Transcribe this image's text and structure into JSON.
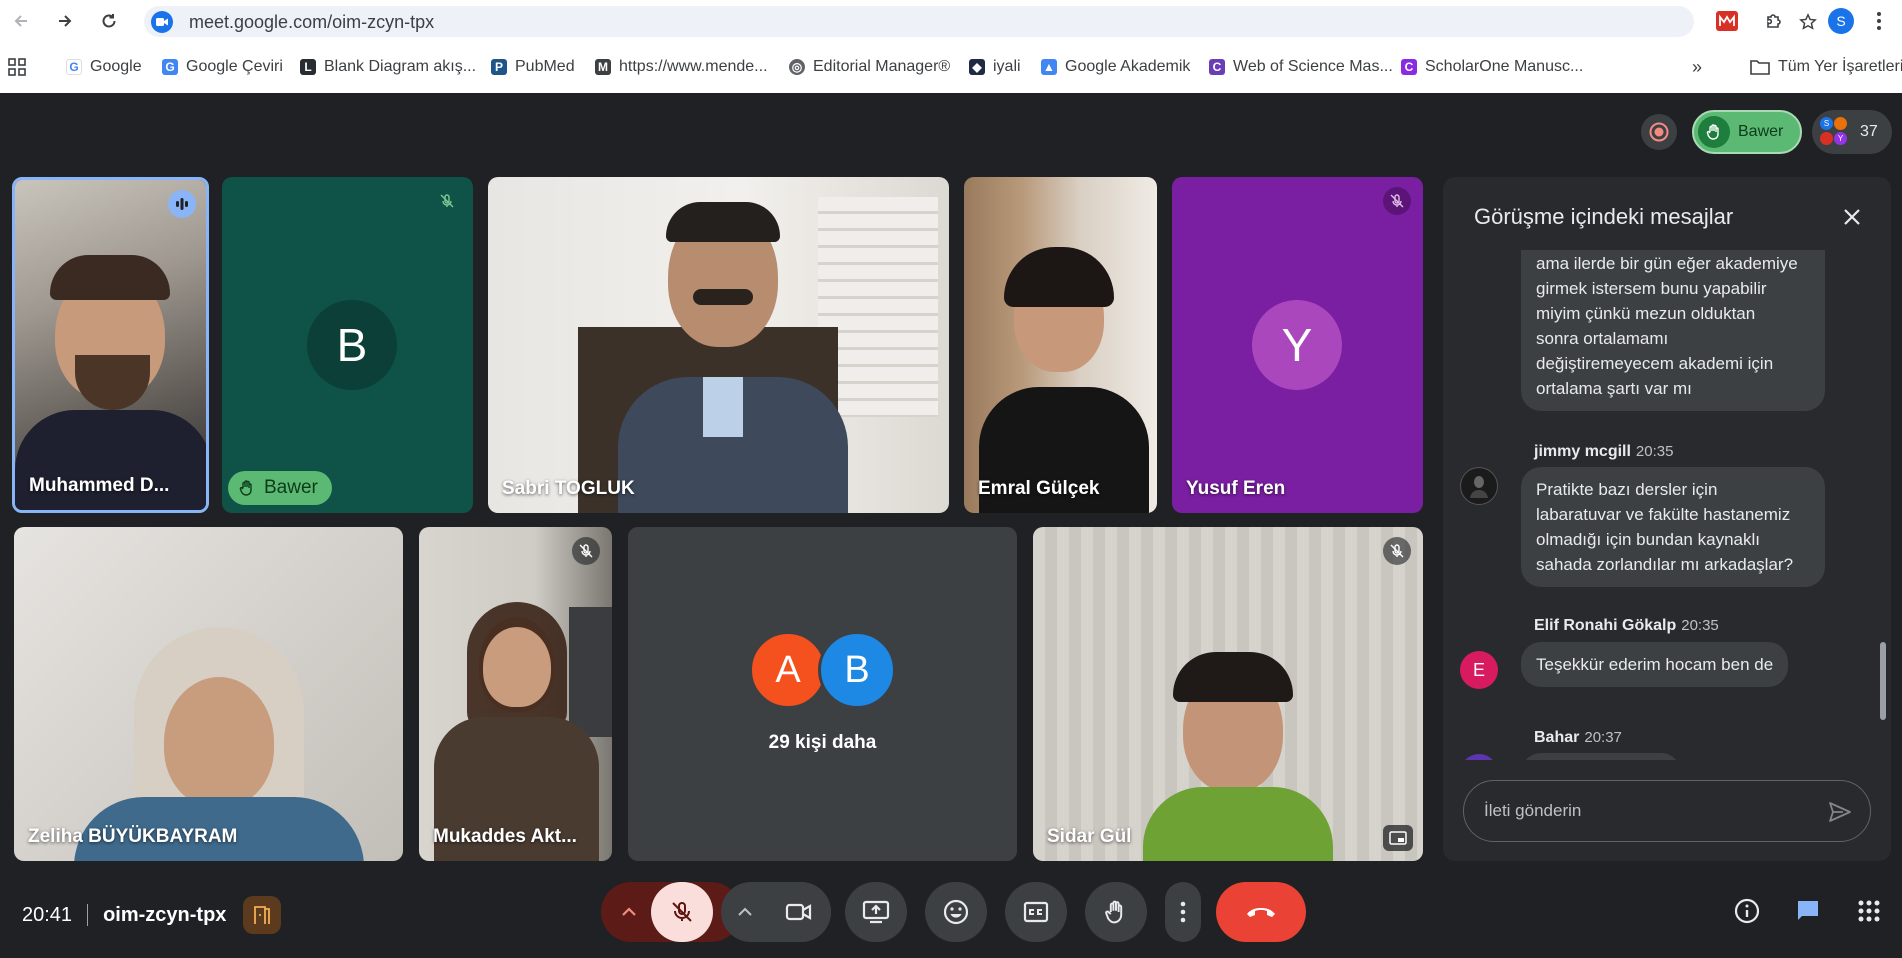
{
  "browser": {
    "url": "meet.google.com/oim-zcyn-tpx",
    "profile_initial": "S",
    "bookmarks": [
      {
        "label": "Google",
        "icon": "google-icon"
      },
      {
        "label": "Google Çeviri",
        "icon": "translate-icon"
      },
      {
        "label": "Blank Diagram akış...",
        "icon": "lucidchart-icon"
      },
      {
        "label": "PubMed",
        "icon": "pubmed-icon"
      },
      {
        "label": "https://www.mende...",
        "icon": "mendeley-icon"
      },
      {
        "label": "Editorial Manager®",
        "icon": "globe-icon"
      },
      {
        "label": "iyali",
        "icon": "iyali-icon"
      },
      {
        "label": "Google Akademik",
        "icon": "scholar-icon"
      },
      {
        "label": "Web of Science Mas...",
        "icon": "wos-icon"
      },
      {
        "label": "ScholarOne Manusc...",
        "icon": "scholarone-icon"
      }
    ],
    "all_bookmarks": "Tüm Yer İşaretleri"
  },
  "meet": {
    "hand_label": "Bawer",
    "participant_count": "37",
    "tiles": [
      {
        "name": "Muhammed D...",
        "type": "video"
      },
      {
        "name": "Bawer",
        "type": "avatar",
        "initial": "B",
        "hand_raised": true
      },
      {
        "name": "Sabri TOGLUK",
        "type": "video"
      },
      {
        "name": "Emral Gülçek",
        "type": "video"
      },
      {
        "name": "Yusuf Eren",
        "type": "avatar",
        "initial": "Y"
      },
      {
        "name": "Zeliha BÜYÜKBAYRAM",
        "type": "video"
      },
      {
        "name": "Mukaddes Akt...",
        "type": "video"
      },
      {
        "name": "29 kişi daha",
        "type": "overflow",
        "initials": [
          "A",
          "B"
        ]
      },
      {
        "name": "Sidar Gül",
        "type": "video"
      }
    ],
    "colors": {
      "bg": "#202124",
      "accent_green": "#5bb974",
      "end_call": "#ea4335",
      "mic_off": "#f9dedc"
    }
  },
  "chat": {
    "title": "Görüşme içindeki mesajlar",
    "messages": [
      {
        "sender": "",
        "time": "",
        "lines": [
          "ama ilerde bir gün eğer akademiye",
          "girmek istersem bunu yapabilir",
          "miyim çünkü mezun olduktan",
          "sonra ortalamamı",
          "değiştiremeyecem akademi için",
          "ortalama şartı var mı"
        ]
      },
      {
        "sender": "jimmy mcgill",
        "time": "20:35",
        "lines": [
          "Pratikte bazı dersler için",
          "labaratuvar ve fakülte hastanemiz",
          "olmadığı için bundan kaynaklı",
          "sahada zorlandılar mı arkadaşlar?"
        ]
      },
      {
        "sender": "Elif Ronahi Gökalp",
        "time": "20:35",
        "initial": "E",
        "lines": [
          "Teşekkür ederim hocam ben de"
        ]
      },
      {
        "sender": "Bahar",
        "time": "20:37",
        "lines": []
      }
    ],
    "input_placeholder": "İleti gönderin"
  },
  "bottom": {
    "time": "20:41",
    "meeting_code": "oim-zcyn-tpx"
  }
}
